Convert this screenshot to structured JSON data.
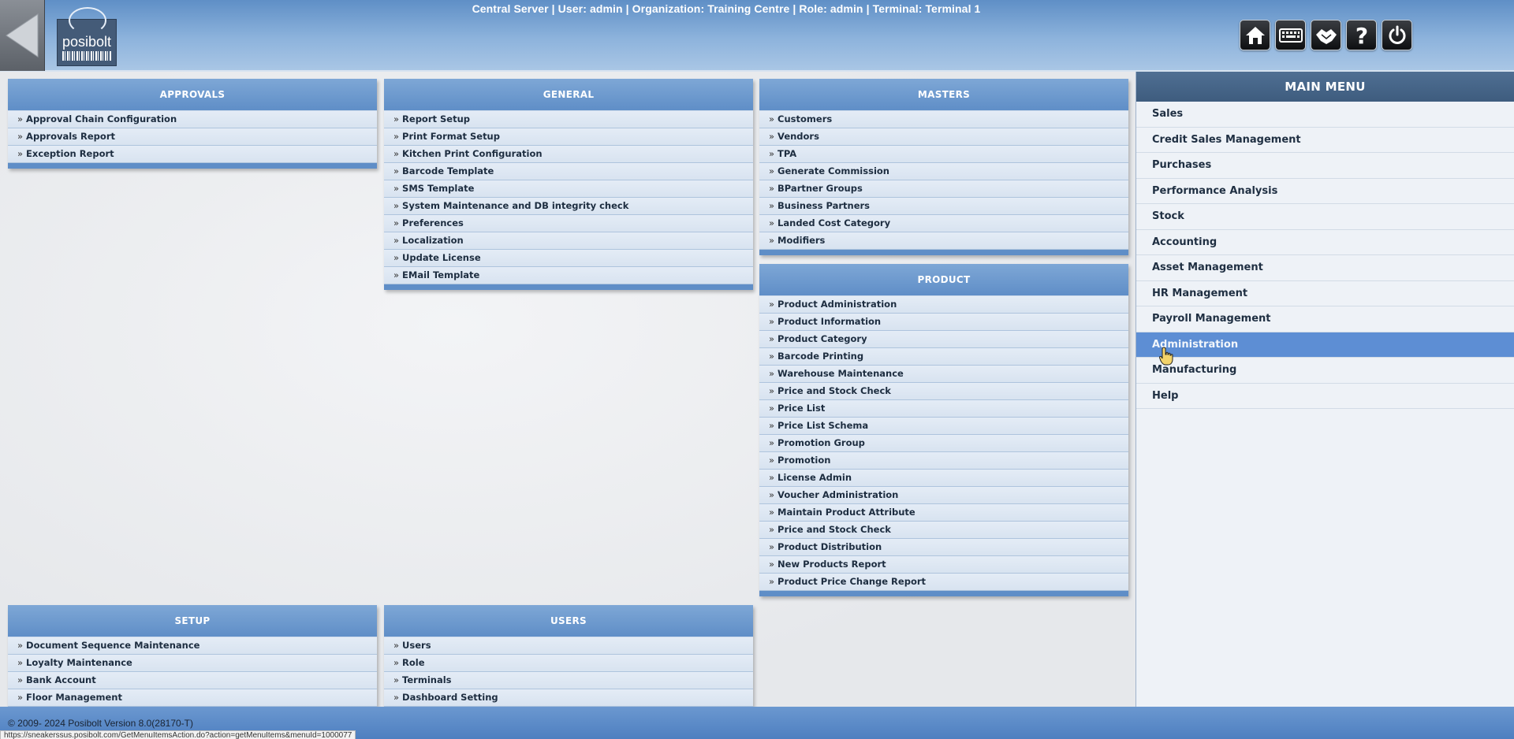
{
  "header": {
    "session_info": "Central Server | User: admin | Organization: Training Centre | Role: admin | Terminal: Terminal 1",
    "logo_text": "posibolt",
    "toolbar": [
      {
        "icon": "home-icon"
      },
      {
        "icon": "keyboard-icon"
      },
      {
        "icon": "handshake-icon"
      },
      {
        "icon": "help-icon"
      },
      {
        "icon": "power-icon"
      }
    ]
  },
  "panels": {
    "approvals": {
      "title": "APPROVALS",
      "items": [
        "Approval Chain Configuration",
        "Approvals Report",
        "Exception Report"
      ]
    },
    "general": {
      "title": "GENERAL",
      "items": [
        "Report Setup",
        "Print Format Setup",
        "Kitchen Print Configuration",
        "Barcode Template",
        "SMS Template",
        "System Maintenance and DB integrity check",
        "Preferences",
        "Localization",
        "Update License",
        "EMail Template"
      ]
    },
    "masters": {
      "title": "MASTERS",
      "items": [
        "Customers",
        "Vendors",
        "TPA",
        "Generate Commission",
        "BPartner Groups",
        "Business Partners",
        "Landed Cost Category",
        "Modifiers"
      ]
    },
    "product": {
      "title": "PRODUCT",
      "items": [
        "Product Administration",
        "Product Information",
        "Product Category",
        "Barcode Printing",
        "Warehouse Maintenance",
        "Price and Stock Check",
        "Price List",
        "Price List Schema",
        "Promotion Group",
        "Promotion",
        "License Admin",
        "Voucher Administration",
        "Maintain Product Attribute",
        "Price and Stock Check",
        "Product Distribution",
        "New Products Report",
        "Product Price Change Report"
      ]
    },
    "setup": {
      "title": "SETUP",
      "items": [
        "Document Sequence Maintenance",
        "Loyalty Maintenance",
        "Bank Account",
        "Floor Management"
      ]
    },
    "users": {
      "title": "USERS",
      "items": [
        "Users",
        "Role",
        "Terminals",
        "Dashboard Setting"
      ]
    }
  },
  "main_menu": {
    "title": "MAIN MENU",
    "active": "Administration",
    "items": [
      "Sales",
      "Credit Sales Management",
      "Purchases",
      "Performance Analysis",
      "Stock",
      "Accounting",
      "Asset Management",
      "HR Management",
      "Payroll Management",
      "Administration",
      "Manufacturing",
      "Help"
    ]
  },
  "footer": {
    "copyright": "© 2009- 2024 Posibolt Version  8.0(28170-T)",
    "status_url": "https://sneakerssus.posibolt.com/GetMenuItemsAction.do?action=getMenuItems&menuId=1000077"
  },
  "colors": {
    "header_blue": "#6b98d0",
    "panel_header": "#5f8ec7",
    "active_menu": "#5d8ed4"
  }
}
